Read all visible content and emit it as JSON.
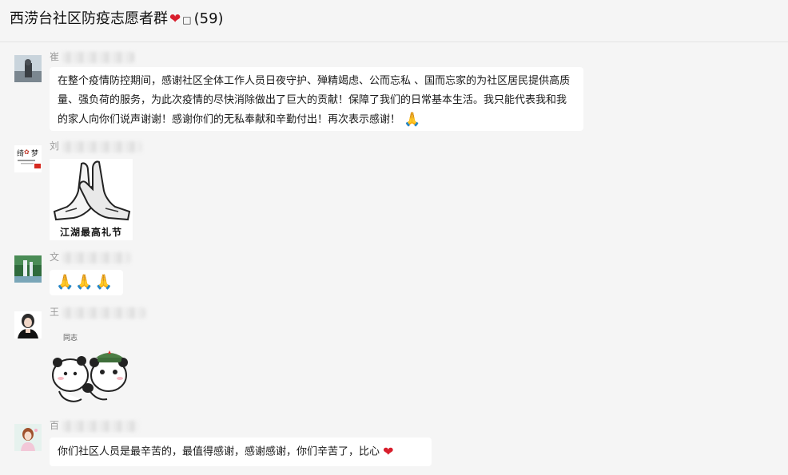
{
  "header": {
    "title": "西涝台社区防疫志愿者群",
    "member_count": "(59)",
    "heart_glyph": "❤",
    "box_glyph": "□"
  },
  "messages": [
    {
      "sender": "崔",
      "text": "在整个疫情防控期间，感谢社区全体工作人员日夜守护、殚精竭虑、公而忘私 、国而忘家的为社区居民提供高质量、强负荷的服务，为此次疫情的尽快消除做出了巨大的贡献！保障了我们的日常基本生活。我只能代表我和我的家人向你们说声谢谢！感谢你们的无私奉献和辛勤付出！再次表示感谢！",
      "emoji": "🙏"
    },
    {
      "sender": "刘",
      "sticker_caption": "江湖最高礼节"
    },
    {
      "sender": "文",
      "emoji": "🙏🙏🙏"
    },
    {
      "sender": "王",
      "sticker_caption": "同志"
    },
    {
      "sender": "百",
      "text": "你们社区人员是最辛苦的，最值得感谢，感谢感谢，你们辛苦了，比心",
      "emoji": "❤"
    }
  ],
  "colors": {
    "background": "#f5f5f5",
    "bubble": "#ffffff",
    "heart": "#d81e2c",
    "name_text": "#9b9b9b"
  }
}
